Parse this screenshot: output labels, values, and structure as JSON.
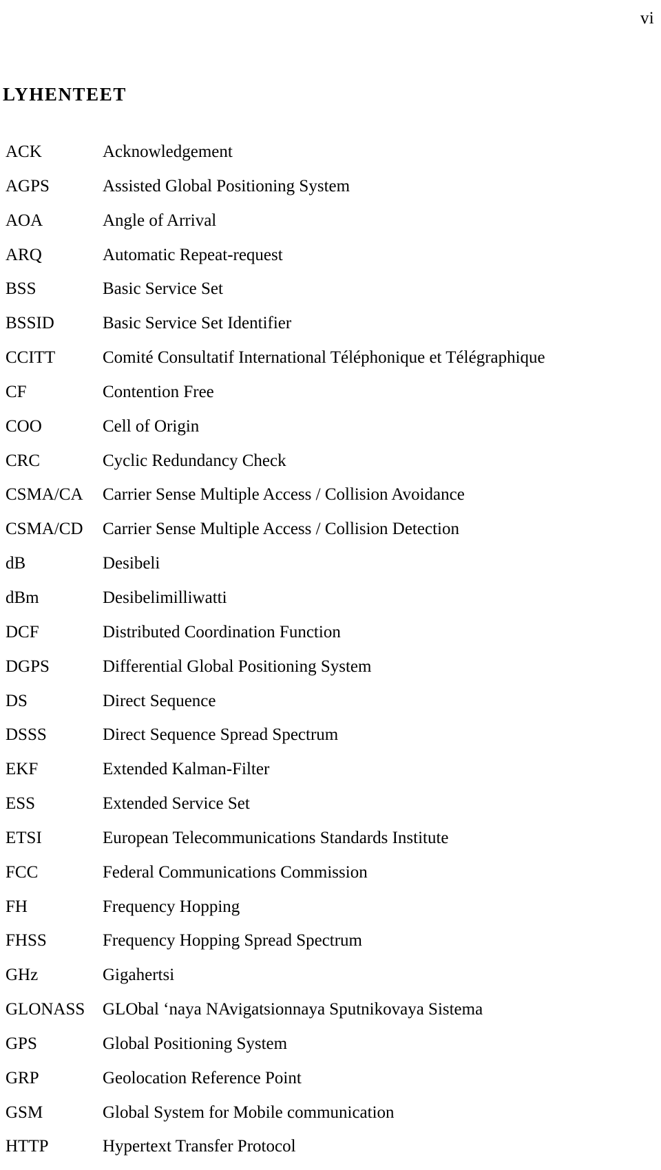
{
  "page": {
    "folio": "vi",
    "section_title": "LYHENTEET"
  },
  "abbreviations": [
    {
      "term": "ACK",
      "definition": "Acknowledgement"
    },
    {
      "term": "AGPS",
      "definition": "Assisted Global Positioning System"
    },
    {
      "term": "AOA",
      "definition": "Angle of Arrival"
    },
    {
      "term": "ARQ",
      "definition": "Automatic Repeat-request"
    },
    {
      "term": "BSS",
      "definition": "Basic Service Set"
    },
    {
      "term": "BSSID",
      "definition": "Basic Service Set Identifier"
    },
    {
      "term": "CCITT",
      "definition": "Comité Consultatif International Téléphonique et Télégraphique"
    },
    {
      "term": "CF",
      "definition": "Contention Free"
    },
    {
      "term": "COO",
      "definition": "Cell of Origin"
    },
    {
      "term": "CRC",
      "definition": "Cyclic Redundancy Check"
    },
    {
      "term": "CSMA/CA",
      "definition": "Carrier Sense Multiple Access / Collision Avoidance"
    },
    {
      "term": "CSMA/CD",
      "definition": "Carrier Sense Multiple Access / Collision Detection"
    },
    {
      "term": "dB",
      "definition": "Desibeli"
    },
    {
      "term": "dBm",
      "definition": "Desibelimilliwatti"
    },
    {
      "term": "DCF",
      "definition": "Distributed Coordination Function"
    },
    {
      "term": "DGPS",
      "definition": "Differential Global Positioning System"
    },
    {
      "term": "DS",
      "definition": "Direct Sequence"
    },
    {
      "term": "DSSS",
      "definition": "Direct Sequence Spread Spectrum"
    },
    {
      "term": "EKF",
      "definition": "Extended Kalman-Filter"
    },
    {
      "term": "ESS",
      "definition": "Extended Service Set"
    },
    {
      "term": "ETSI",
      "definition": "European Telecommunications Standards Institute"
    },
    {
      "term": "FCC",
      "definition": "Federal Communications Commission"
    },
    {
      "term": "FH",
      "definition": "Frequency Hopping"
    },
    {
      "term": "FHSS",
      "definition": "Frequency Hopping Spread Spectrum"
    },
    {
      "term": "GHz",
      "definition": "Gigahertsi"
    },
    {
      "term": "GLONASS",
      "definition": "GLObal ‘naya NAvigatsionnaya Sputnikovaya Sistema"
    },
    {
      "term": "GPS",
      "definition": "Global Positioning System"
    },
    {
      "term": "GRP",
      "definition": "Geolocation Reference Point"
    },
    {
      "term": "GSM",
      "definition": "Global System for Mobile communication"
    },
    {
      "term": "HTTP",
      "definition": "Hypertext Transfer Protocol"
    }
  ]
}
